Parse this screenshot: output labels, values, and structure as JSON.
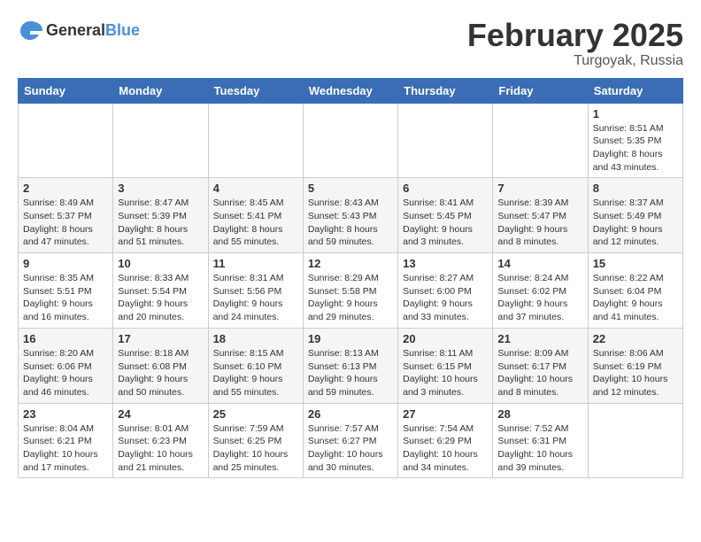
{
  "header": {
    "logo_general": "General",
    "logo_blue": "Blue",
    "month_year": "February 2025",
    "location": "Turgoyak, Russia"
  },
  "days_of_week": [
    "Sunday",
    "Monday",
    "Tuesday",
    "Wednesday",
    "Thursday",
    "Friday",
    "Saturday"
  ],
  "weeks": [
    [
      {
        "day": "",
        "info": ""
      },
      {
        "day": "",
        "info": ""
      },
      {
        "day": "",
        "info": ""
      },
      {
        "day": "",
        "info": ""
      },
      {
        "day": "",
        "info": ""
      },
      {
        "day": "",
        "info": ""
      },
      {
        "day": "1",
        "info": "Sunrise: 8:51 AM\nSunset: 5:35 PM\nDaylight: 8 hours and 43 minutes."
      }
    ],
    [
      {
        "day": "2",
        "info": "Sunrise: 8:49 AM\nSunset: 5:37 PM\nDaylight: 8 hours and 47 minutes."
      },
      {
        "day": "3",
        "info": "Sunrise: 8:47 AM\nSunset: 5:39 PM\nDaylight: 8 hours and 51 minutes."
      },
      {
        "day": "4",
        "info": "Sunrise: 8:45 AM\nSunset: 5:41 PM\nDaylight: 8 hours and 55 minutes."
      },
      {
        "day": "5",
        "info": "Sunrise: 8:43 AM\nSunset: 5:43 PM\nDaylight: 8 hours and 59 minutes."
      },
      {
        "day": "6",
        "info": "Sunrise: 8:41 AM\nSunset: 5:45 PM\nDaylight: 9 hours and 3 minutes."
      },
      {
        "day": "7",
        "info": "Sunrise: 8:39 AM\nSunset: 5:47 PM\nDaylight: 9 hours and 8 minutes."
      },
      {
        "day": "8",
        "info": "Sunrise: 8:37 AM\nSunset: 5:49 PM\nDaylight: 9 hours and 12 minutes."
      }
    ],
    [
      {
        "day": "9",
        "info": "Sunrise: 8:35 AM\nSunset: 5:51 PM\nDaylight: 9 hours and 16 minutes."
      },
      {
        "day": "10",
        "info": "Sunrise: 8:33 AM\nSunset: 5:54 PM\nDaylight: 9 hours and 20 minutes."
      },
      {
        "day": "11",
        "info": "Sunrise: 8:31 AM\nSunset: 5:56 PM\nDaylight: 9 hours and 24 minutes."
      },
      {
        "day": "12",
        "info": "Sunrise: 8:29 AM\nSunset: 5:58 PM\nDaylight: 9 hours and 29 minutes."
      },
      {
        "day": "13",
        "info": "Sunrise: 8:27 AM\nSunset: 6:00 PM\nDaylight: 9 hours and 33 minutes."
      },
      {
        "day": "14",
        "info": "Sunrise: 8:24 AM\nSunset: 6:02 PM\nDaylight: 9 hours and 37 minutes."
      },
      {
        "day": "15",
        "info": "Sunrise: 8:22 AM\nSunset: 6:04 PM\nDaylight: 9 hours and 41 minutes."
      }
    ],
    [
      {
        "day": "16",
        "info": "Sunrise: 8:20 AM\nSunset: 6:06 PM\nDaylight: 9 hours and 46 minutes."
      },
      {
        "day": "17",
        "info": "Sunrise: 8:18 AM\nSunset: 6:08 PM\nDaylight: 9 hours and 50 minutes."
      },
      {
        "day": "18",
        "info": "Sunrise: 8:15 AM\nSunset: 6:10 PM\nDaylight: 9 hours and 55 minutes."
      },
      {
        "day": "19",
        "info": "Sunrise: 8:13 AM\nSunset: 6:13 PM\nDaylight: 9 hours and 59 minutes."
      },
      {
        "day": "20",
        "info": "Sunrise: 8:11 AM\nSunset: 6:15 PM\nDaylight: 10 hours and 3 minutes."
      },
      {
        "day": "21",
        "info": "Sunrise: 8:09 AM\nSunset: 6:17 PM\nDaylight: 10 hours and 8 minutes."
      },
      {
        "day": "22",
        "info": "Sunrise: 8:06 AM\nSunset: 6:19 PM\nDaylight: 10 hours and 12 minutes."
      }
    ],
    [
      {
        "day": "23",
        "info": "Sunrise: 8:04 AM\nSunset: 6:21 PM\nDaylight: 10 hours and 17 minutes."
      },
      {
        "day": "24",
        "info": "Sunrise: 8:01 AM\nSunset: 6:23 PM\nDaylight: 10 hours and 21 minutes."
      },
      {
        "day": "25",
        "info": "Sunrise: 7:59 AM\nSunset: 6:25 PM\nDaylight: 10 hours and 25 minutes."
      },
      {
        "day": "26",
        "info": "Sunrise: 7:57 AM\nSunset: 6:27 PM\nDaylight: 10 hours and 30 minutes."
      },
      {
        "day": "27",
        "info": "Sunrise: 7:54 AM\nSunset: 6:29 PM\nDaylight: 10 hours and 34 minutes."
      },
      {
        "day": "28",
        "info": "Sunrise: 7:52 AM\nSunset: 6:31 PM\nDaylight: 10 hours and 39 minutes."
      },
      {
        "day": "",
        "info": ""
      }
    ]
  ]
}
